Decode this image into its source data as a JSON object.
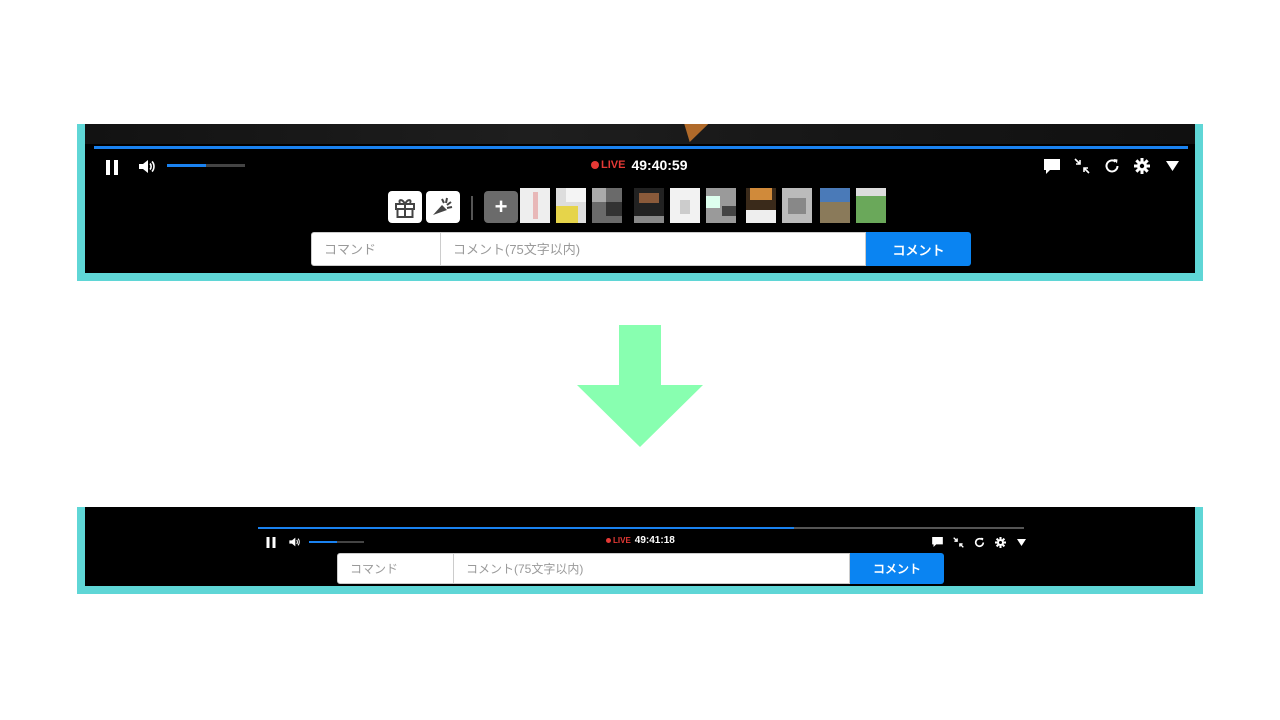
{
  "colors": {
    "frame_border": "#5fd6d6",
    "player_bg": "#000000",
    "accent_blue": "#0a84f2",
    "live_red": "#e53935",
    "arrow_green": "#88ffb0"
  },
  "before": {
    "seek_progress": 1.0,
    "volume_level": 0.5,
    "live_label": "LIVE",
    "elapsed_time": "49:40:59",
    "right_controls": [
      "comment-icon",
      "minimize-icon",
      "reload-icon",
      "settings-icon",
      "menu-triangle-icon"
    ],
    "action_buttons": [
      "gift-icon",
      "party-popper-icon"
    ],
    "plus_label": "+",
    "thumbnail_count": 11,
    "command_placeholder": "コマンド",
    "comment_placeholder": "コメント(75文字以内)",
    "send_label": "コメント"
  },
  "after": {
    "seek_progress": 0.7,
    "volume_level": 0.5,
    "live_label": "LIVE",
    "elapsed_time": "49:41:18",
    "right_controls": [
      "comment-icon",
      "minimize-icon",
      "reload-icon",
      "settings-icon",
      "menu-triangle-icon"
    ],
    "command_placeholder": "コマンド",
    "comment_placeholder": "コメント(75文字以内)",
    "send_label": "コメント"
  },
  "transition_arrow": "down-arrow-icon"
}
